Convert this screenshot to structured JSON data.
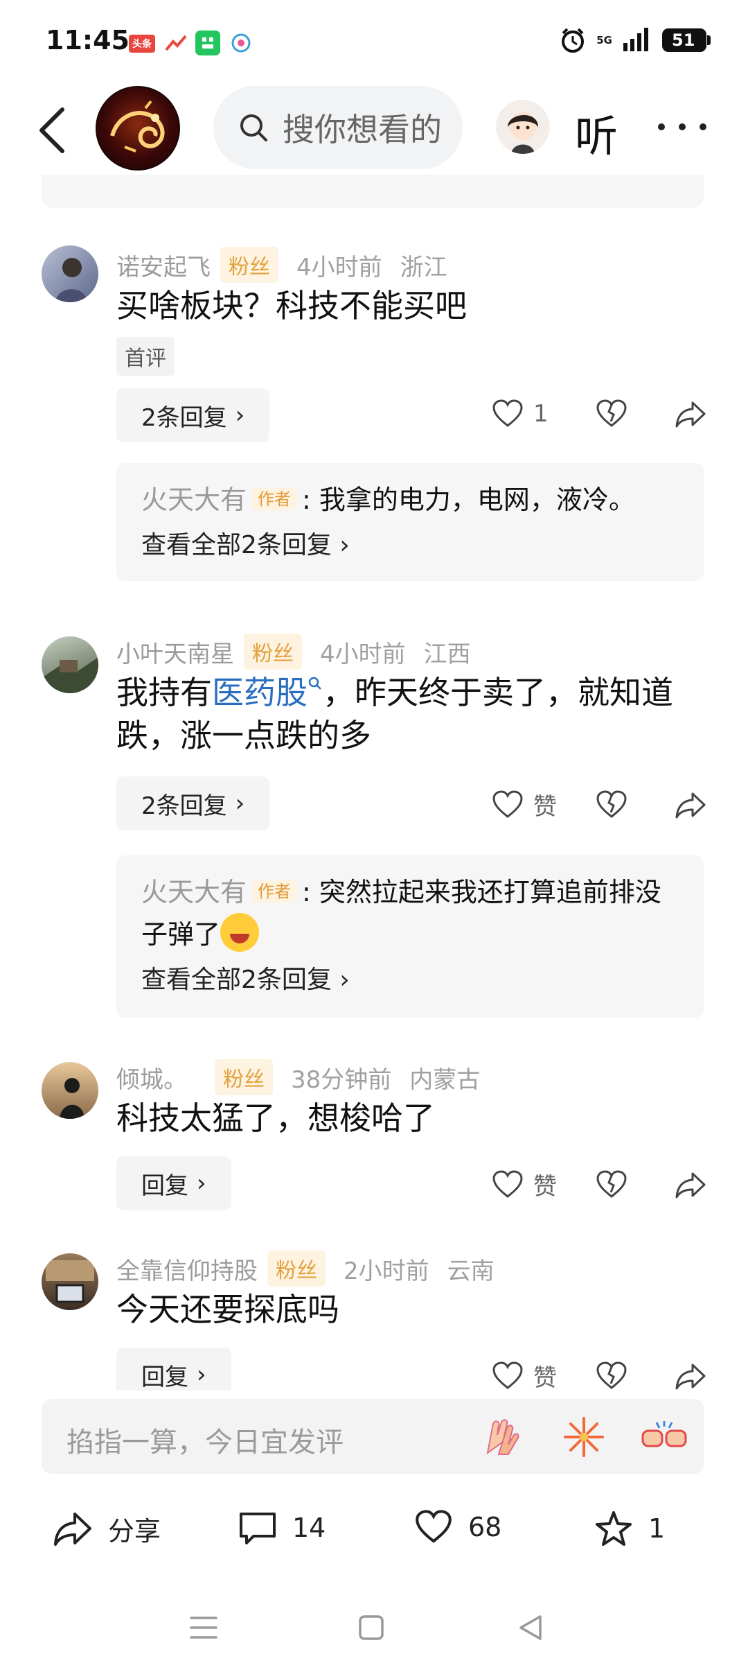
{
  "status_bar": {
    "time": "11:45",
    "app_icons": [
      "头条",
      "stock-app",
      "wechat-green",
      "mobile-app"
    ],
    "network": "5G",
    "battery": "51"
  },
  "top_nav": {
    "search_placeholder": "搜你想看的",
    "listen_label": "听"
  },
  "comments": [
    {
      "name": "诺安起飞",
      "badge": "粉丝",
      "time": "4小时前",
      "location": "浙江",
      "text": "买啥板块？科技不能买吧",
      "first_tag": "首评",
      "reply_label": "2条回复",
      "like_count": "1",
      "subreply": {
        "author": "火天大有",
        "author_badge": "作者",
        "text": ": 我拿的电力，电网，液冷。",
        "view_all": "查看全部2条回复"
      }
    },
    {
      "name": "小叶天南星",
      "badge": "粉丝",
      "time": "4小时前",
      "location": "江西",
      "text_before": "我持有",
      "keyword": "医药股",
      "text_after": "，昨天终于卖了，就知道跌，涨一点跌的多",
      "reply_label": "2条回复",
      "like_count": "赞",
      "subreply": {
        "author": "火天大有",
        "author_badge": "作者",
        "text": ": 突然拉起来我还打算追前排没子弹了",
        "view_all": "查看全部2条回复"
      }
    },
    {
      "name": "倾城。",
      "badge": "粉丝",
      "time": "38分钟前",
      "location": "内蒙古",
      "text": "科技太猛了，想梭哈了",
      "reply_label": "回复",
      "like_count": "赞"
    },
    {
      "name": "全靠信仰持股",
      "badge": "粉丝",
      "time": "2小时前",
      "location": "云南",
      "text": "今天还要探底吗",
      "reply_label": "回复",
      "like_count": "赞"
    }
  ],
  "input_bar": {
    "placeholder": "掐指一算，今日宜发评"
  },
  "bottom_bar": {
    "share_label": "分享",
    "comment_count": "14",
    "like_count": "68",
    "favorite_count": "1"
  }
}
